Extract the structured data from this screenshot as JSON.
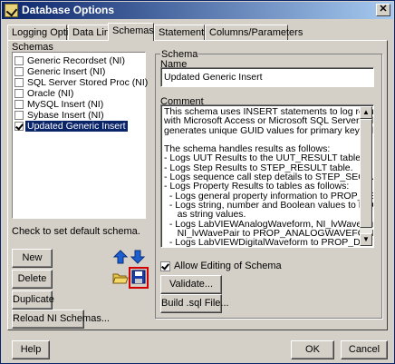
{
  "window": {
    "title": "Database Options",
    "close_glyph": "✕"
  },
  "tabs": [
    "Logging Options",
    "Data Link",
    "Schemas",
    "Statements",
    "Columns/Parameters"
  ],
  "active_tab": "Schemas",
  "schemas": {
    "label": "Schemas",
    "items": [
      {
        "label": "Generic Recordset (NI)",
        "checked": false,
        "selected": false
      },
      {
        "label": "Generic Insert (NI)",
        "checked": false,
        "selected": false
      },
      {
        "label": "SQL Server Stored Proc (NI)",
        "checked": false,
        "selected": false
      },
      {
        "label": "Oracle (NI)",
        "checked": false,
        "selected": false
      },
      {
        "label": "MySQL Insert (NI)",
        "checked": false,
        "selected": false
      },
      {
        "label": "Sybase Insert (NI)",
        "checked": false,
        "selected": false
      },
      {
        "label": "Updated Generic Insert",
        "checked": true,
        "selected": true
      }
    ],
    "hint": "Check to set default schema."
  },
  "buttons": {
    "new": "New",
    "delete": "Delete",
    "duplicate": "Duplicate",
    "reload": "Reload NI Schemas...",
    "validate": "Validate...",
    "build_sql": "Build .sql File...",
    "help": "Help",
    "ok": "OK",
    "cancel": "Cancel"
  },
  "icons": {
    "move_up": "arrow-up-icon",
    "move_down": "arrow-down-icon",
    "open": "folder-open-icon",
    "save": "floppy-disk-icon"
  },
  "schema_group": {
    "title": "Schema",
    "name_label": "Name",
    "name_value": "Updated Generic Insert",
    "comment_label": "Comment",
    "comment_value": "This schema uses INSERT statements to log results and supports use\nwith Microsoft Access or Microsoft SQL Server.  The schema\ngenerates unique GUID values for primary key values.\n\nThe schema handles results as follows:\n- Logs UUT Results to the UUT_RESULT table.\n- Logs Step Results to STEP_RESULT table.\n- Logs sequence call step details to STEP_SEQCALL table.\n- Logs Property Results to tables as follows:\n  - Logs general property information to PROP_RESULT.\n  - Logs string, number and Boolean values to PROP_RESULT\n     as string values.\n  - Logs LabVIEWAnalogWaveform, NI_lvWave, and\n     NI_lvWavePair to PROP_ANALOGWAVEFORM.\n  - Logs LabVIEWDigitalWaveform to PROP_DIGITALWAVEFORM\n  - Logs Numeric Limit Test and Multiple Numeric Limit Test results to\n     PROP_NUMERICLIMIT.",
    "allow_editing_label": "Allow Editing of Schema",
    "allow_editing_checked": true
  },
  "colors": {
    "selection": "#0a246a",
    "highlight_box": "#d00000",
    "arrow_blue": "#1c5fd0",
    "floppy_blue": "#1a3ca8"
  }
}
